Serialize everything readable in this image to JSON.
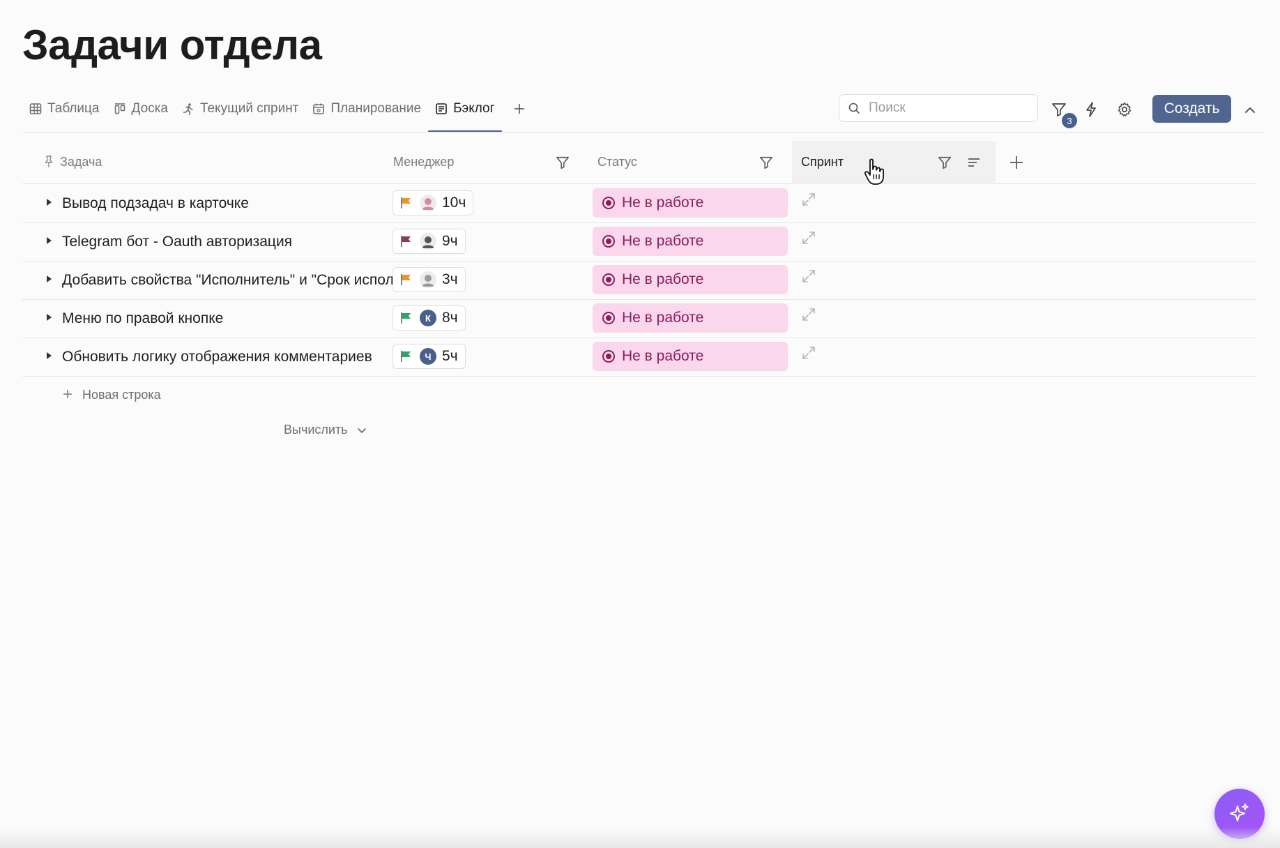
{
  "page": {
    "title": "Задачи отдела"
  },
  "tabs": [
    {
      "label": "Таблица",
      "icon": "table-icon"
    },
    {
      "label": "Доска",
      "icon": "board-icon"
    },
    {
      "label": "Текущий спринт",
      "icon": "running-icon"
    },
    {
      "label": "Планирование",
      "icon": "calendar-icon"
    },
    {
      "label": "Бэклог",
      "icon": "backlog-icon",
      "active": true
    }
  ],
  "toolbar": {
    "search_placeholder": "Поиск",
    "filter_count": "3",
    "create_label": "Создать"
  },
  "columns": {
    "task": "Задача",
    "manager": "Менеджер",
    "status": "Статус",
    "sprint": "Спринт"
  },
  "rows": [
    {
      "task": "Вывод подзадач в карточке",
      "flag_color": "#e8962b",
      "avatar": {
        "type": "photo",
        "color": "#d48aa6",
        "letter": ""
      },
      "hours": "10ч",
      "status": "Не в работе"
    },
    {
      "task": "Telegram бот - Oauth авторизация",
      "flag_color": "#8a3a63",
      "avatar": {
        "type": "photo",
        "color": "#555555",
        "letter": ""
      },
      "hours": "9ч",
      "status": "Не в работе"
    },
    {
      "task": "Добавить свойства \"Исполнитель\" и \"Срок исполнения\"",
      "flag_color": "#e8962b",
      "avatar": {
        "type": "photo",
        "color": "#9a9a9a",
        "letter": ""
      },
      "hours": "3ч",
      "status": "Не в работе"
    },
    {
      "task": "Меню по правой кнопке",
      "flag_color": "#2fa36b",
      "avatar": {
        "type": "letter",
        "color": "#4b5f8c",
        "letter": "К"
      },
      "hours": "8ч",
      "status": "Не в работе"
    },
    {
      "task": "Обновить логику отображения комментариев",
      "flag_color": "#2fa36b",
      "avatar": {
        "type": "letter",
        "color": "#4b5f8c",
        "letter": "Ч"
      },
      "hours": "5ч",
      "status": "Не в работе"
    }
  ],
  "footer": {
    "new_row_label": "Новая строка",
    "calculate_label": "Вычислить"
  },
  "colors": {
    "accent": "#51668f",
    "status_bg": "#fad7ec",
    "status_text": "#8a1d5c"
  }
}
